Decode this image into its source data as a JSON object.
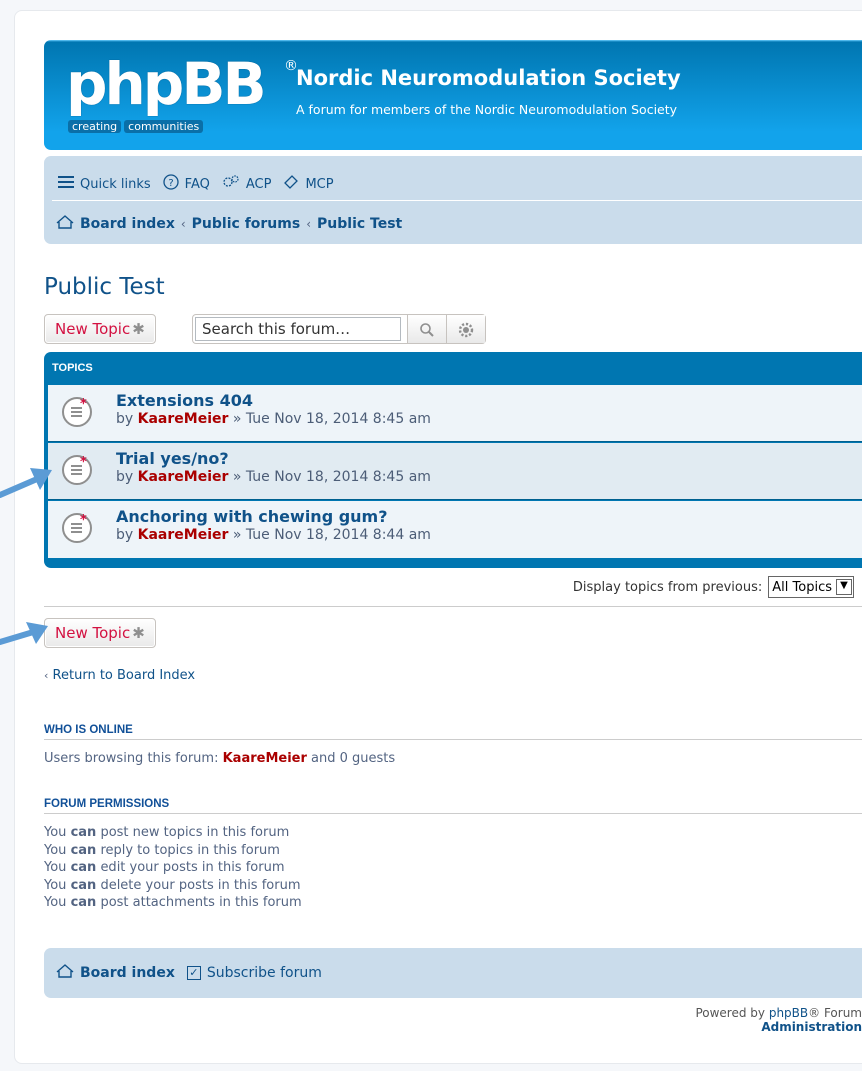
{
  "header": {
    "logo_text": "phpBB",
    "logo_reg": "®",
    "logo_tag": [
      "creating",
      "communities"
    ],
    "site_title": "Nordic Neuromodulation Society",
    "site_desc": "A forum for members of the Nordic Neuromodulation Society"
  },
  "navbar": {
    "quick_links": "Quick links",
    "faq": "FAQ",
    "acp": "ACP",
    "mcp": "MCP",
    "breadcrumbs": [
      "Board index",
      "Public forums",
      "Public Test"
    ]
  },
  "forum": {
    "title": "Public Test",
    "new_topic": "New Topic",
    "search_placeholder": "Search this forum…",
    "topics_header": "TOPICS",
    "topics": [
      {
        "title": "Extensions 404",
        "by": "by",
        "author": "KaareMeier",
        "date": "» Tue Nov 18, 2014 8:45 am"
      },
      {
        "title": "Trial yes/no?",
        "by": "by",
        "author": "KaareMeier",
        "date": "» Tue Nov 18, 2014 8:45 am"
      },
      {
        "title": "Anchoring with chewing gum?",
        "by": "by",
        "author": "KaareMeier",
        "date": "» Tue Nov 18, 2014 8:44 am"
      }
    ],
    "display_label": "Display topics from previous:",
    "display_value": "All Topics",
    "return_link": "Return to Board Index"
  },
  "online": {
    "heading": "WHO IS ONLINE",
    "prefix": "Users browsing this forum:",
    "user": "KaareMeier",
    "suffix": "and 0 guests"
  },
  "permissions": {
    "heading": "FORUM PERMISSIONS",
    "lines": [
      {
        "a": "You",
        "b": "can",
        "c": "post new topics in this forum"
      },
      {
        "a": "You",
        "b": "can",
        "c": "reply to topics in this forum"
      },
      {
        "a": "You",
        "b": "can",
        "c": "edit your posts in this forum"
      },
      {
        "a": "You",
        "b": "can",
        "c": "delete your posts in this forum"
      },
      {
        "a": "You",
        "b": "can",
        "c": "post attachments in this forum"
      }
    ]
  },
  "footer": {
    "board_index": "Board index",
    "subscribe": "Subscribe forum",
    "powered_prefix": "Powered by",
    "powered_link": "phpBB",
    "powered_suffix": "® Forum",
    "admin": "Administration"
  },
  "colors": {
    "accent": "#12a3eb",
    "brand_dark": "#0076b1",
    "new_topic": "#d31141",
    "username": "#aa0000",
    "annotation_arrow": "#5b9bd5"
  }
}
